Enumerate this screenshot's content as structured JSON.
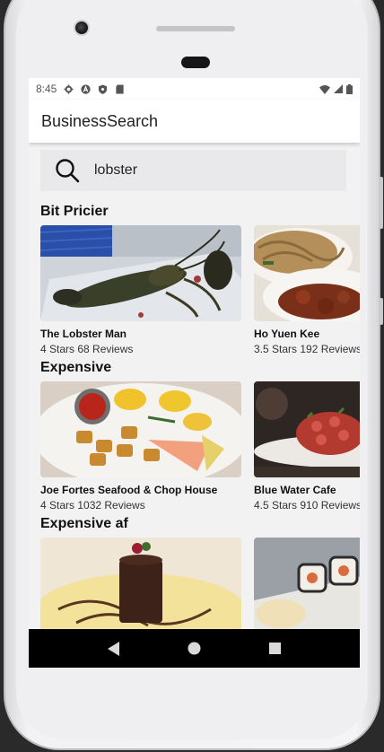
{
  "status_bar": {
    "time": "8:45"
  },
  "app": {
    "title": "BusinessSearch"
  },
  "search": {
    "value": "lobster",
    "placeholder": "Search"
  },
  "sections": [
    {
      "title": "Bit Pricier",
      "items": [
        {
          "name": "The Lobster Man",
          "meta": "4 Stars 68 Reviews"
        },
        {
          "name": "Ho Yuen Kee",
          "meta": "3.5 Stars 192 Reviews"
        }
      ]
    },
    {
      "title": "Expensive",
      "items": [
        {
          "name": "Joe Fortes Seafood & Chop House",
          "meta": "4 Stars 1032 Reviews"
        },
        {
          "name": "Blue Water Cafe",
          "meta": "4.5 Stars 910 Reviews"
        }
      ]
    },
    {
      "title": "Expensive af",
      "items": [
        {
          "name": "",
          "meta": ""
        },
        {
          "name": "",
          "meta": ""
        }
      ]
    }
  ],
  "colors": {
    "appbar": "#ffffff",
    "screen_bg": "#f2f2f2",
    "search_bg": "#e9e9ec",
    "navbar": "#000000"
  },
  "icons": [
    "settings-icon",
    "a-icon",
    "shield-icon",
    "sd-card-icon",
    "wifi-icon",
    "signal-icon",
    "battery-icon",
    "search-icon",
    "back-icon",
    "home-icon",
    "recents-icon"
  ]
}
